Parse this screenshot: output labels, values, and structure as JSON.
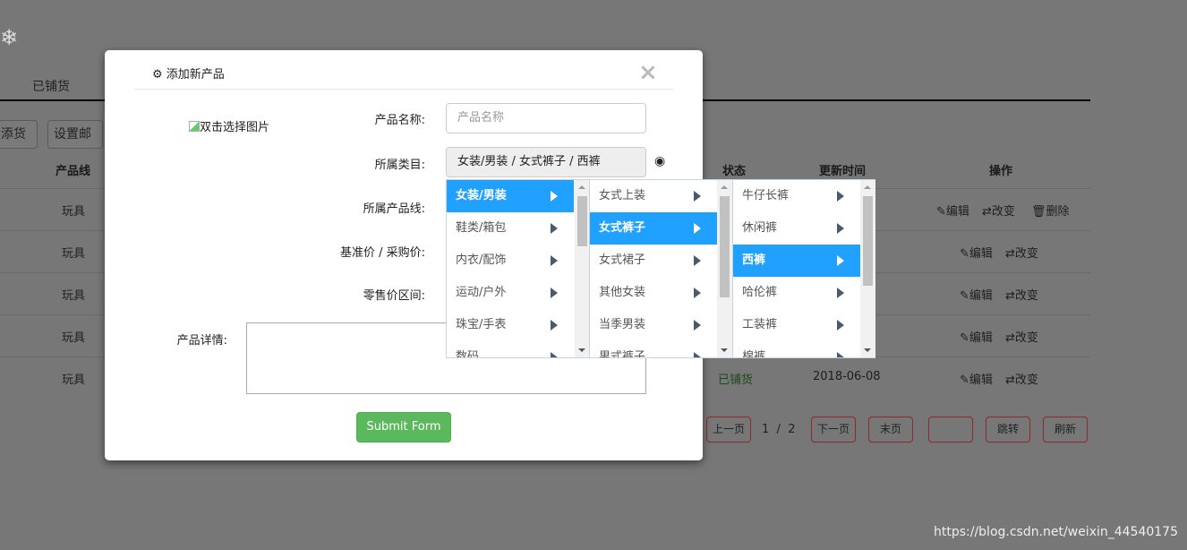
{
  "background": {
    "tab": "已铺货",
    "buttons": [
      "添货",
      "设置邮"
    ],
    "headers": {
      "line": "产品线",
      "status": "状态",
      "updated": "更新时间",
      "actions": "操作"
    },
    "rows": [
      {
        "line": "玩具",
        "actions": [
          "编辑",
          "改变",
          "删除"
        ]
      },
      {
        "line": "玩具",
        "actions": [
          "编辑",
          "改变"
        ]
      },
      {
        "line": "玩具",
        "actions": [
          "编辑",
          "改变"
        ]
      },
      {
        "line": "玩具",
        "actions": [
          "编辑",
          "改变"
        ]
      },
      {
        "line": "玩具",
        "status": "已铺货",
        "updated": "2018-06-08",
        "actions": [
          "编辑",
          "改变"
        ]
      }
    ],
    "pagination": {
      "prev": "上一页",
      "current": "1",
      "sep": "/",
      "total": "2",
      "next": "下一页",
      "last": "末页",
      "jump_value": "",
      "jump": "跳转",
      "refresh": "刷新"
    },
    "watermark": "https://blog.csdn.net/weixin_44540175"
  },
  "modal": {
    "title": "添加新产品",
    "close": "×",
    "image_alt": "双击选择图片",
    "labels": {
      "name": "产品名称:",
      "category": "所属类目:",
      "product_line": "所属产品线:",
      "price": "基准价 / 采购价:",
      "retail": "零售价区间:",
      "detail": "产品详情:"
    },
    "name_placeholder": "产品名称",
    "category_value": "女装/男装 / 女式裤子 / 西裤",
    "submit": "Submit Form",
    "cascader": [
      {
        "items": [
          "女装/男装",
          "鞋类/箱包",
          "内衣/配饰",
          "运动/户外",
          "珠宝/手表",
          "数码"
        ],
        "selected": 0
      },
      {
        "items": [
          "女式上装",
          "女式裤子",
          "女式裙子",
          "其他女装",
          "当季男装",
          "男式裤子"
        ],
        "selected": 1
      },
      {
        "items": [
          "牛仔长裤",
          "休闲裤",
          "西裤",
          "哈伦裤",
          "工装裤",
          "棉裤"
        ],
        "selected": 2
      }
    ]
  },
  "colors": {
    "accent": "#20a0ff",
    "success": "#5cb85c",
    "status_green": "#3c763d",
    "overlay": "#777777"
  }
}
